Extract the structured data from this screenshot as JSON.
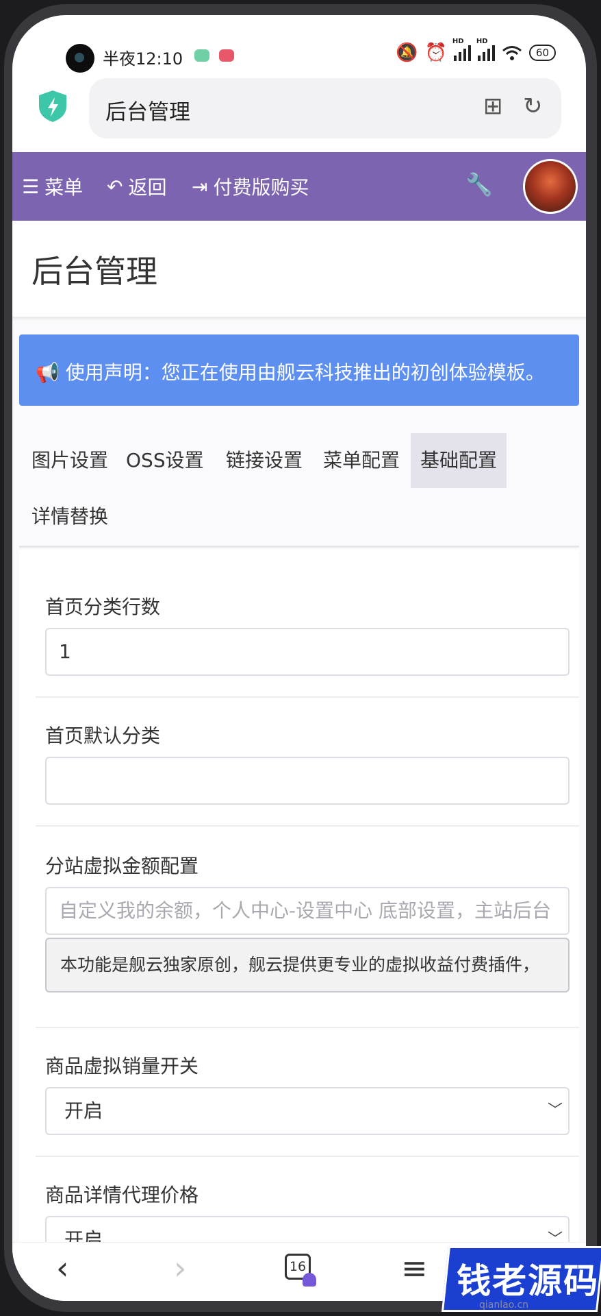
{
  "status_bar": {
    "time": "半夜12:10",
    "battery": "60",
    "hd1": "HD",
    "hd2": "HD"
  },
  "browser": {
    "address_title": "后台管理"
  },
  "navbar": {
    "menu": "菜单",
    "back": "返回",
    "buy": "付费版购买"
  },
  "page": {
    "title": "后台管理",
    "notice": "使用声明：您正在使用由舰云科技推出的初创体验模板。"
  },
  "tabs": [
    {
      "label": "图片设置",
      "active": false
    },
    {
      "label": "OSS设置",
      "active": false
    },
    {
      "label": "链接设置",
      "active": false
    },
    {
      "label": "菜单配置",
      "active": false
    },
    {
      "label": "基础配置",
      "active": true
    },
    {
      "label": "详情替换",
      "active": false
    }
  ],
  "form": {
    "rows_label": "首页分类行数",
    "rows_value": "1",
    "default_cat_label": "首页默认分类",
    "default_cat_value": "",
    "virtual_amount_label": "分站虚拟金额配置",
    "virtual_amount_placeholder": "自定义我的余额，个人中心-设置中心 底部设置，主站后台",
    "virtual_amount_hint": "本功能是舰云独家原创，舰云提供更专业的虚拟收益付费插件，",
    "virtual_sales_label": "商品虚拟销量开关",
    "virtual_sales_value": "开启",
    "agent_price_label": "商品详情代理价格",
    "agent_price_value": "开启"
  },
  "bottom_nav": {
    "tab_count": "16"
  },
  "watermark": {
    "text": "钱老源码",
    "domain": "qianlao.cn"
  },
  "colors": {
    "navbar": "#7d64b0",
    "notice": "#5c8ff0",
    "active_tab": "#e4e2ea"
  }
}
